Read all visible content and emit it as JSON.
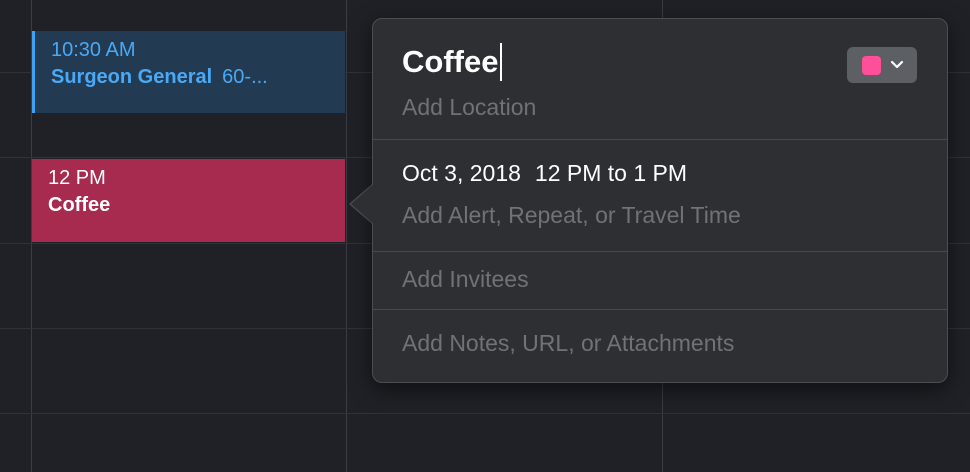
{
  "calendar": {
    "events": [
      {
        "time": "10:30 AM",
        "title": "Surgeon General",
        "duration": "60-...",
        "color": "#3ea1f4"
      },
      {
        "time": "12 PM",
        "title": "Coffee",
        "color": "#a62b4f"
      }
    ]
  },
  "popover": {
    "title": "Coffee",
    "calendar_color": "#ff4f9b",
    "color_picker_icon": "chevron-down-icon",
    "location_placeholder": "Add Location",
    "date": "Oct 3, 2018",
    "time_range": "12 PM to 1 PM",
    "alert_placeholder": "Add Alert, Repeat, or Travel Time",
    "invitees_placeholder": "Add Invitees",
    "notes_placeholder": "Add Notes, URL, or Attachments"
  }
}
